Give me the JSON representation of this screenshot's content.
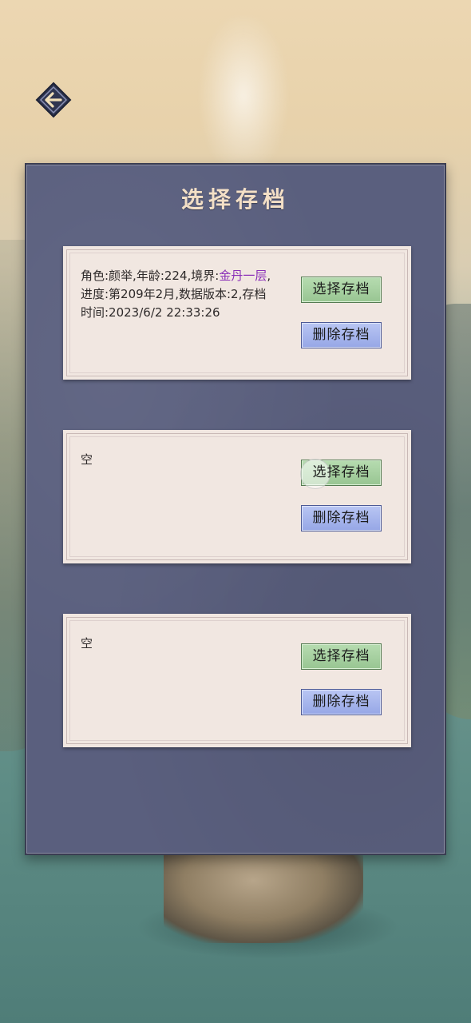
{
  "header": {
    "back_icon": "arrow-left-icon"
  },
  "panel": {
    "title": "选择存档"
  },
  "slots": [
    {
      "info_prefix": "角色:颜举,年龄:224,境界:",
      "realm": "金丹一层",
      "info_suffix": ",进度:第209年2月,数据版本:2,存档时间:2023/6/2 22:33:26",
      "select_label": "选择存档",
      "delete_label": "删除存档"
    },
    {
      "empty_label": "空",
      "select_label": "选择存档",
      "delete_label": "删除存档"
    },
    {
      "empty_label": "空",
      "select_label": "选择存档",
      "delete_label": "删除存档"
    }
  ],
  "colors": {
    "panel_bg": "#5a5f7e",
    "card_bg": "#f1e7e1",
    "select_btn": "#a8d1a2",
    "delete_btn": "#a7b6ec",
    "realm_text": "#8a2fb8",
    "title_text": "#f3dfc6"
  }
}
